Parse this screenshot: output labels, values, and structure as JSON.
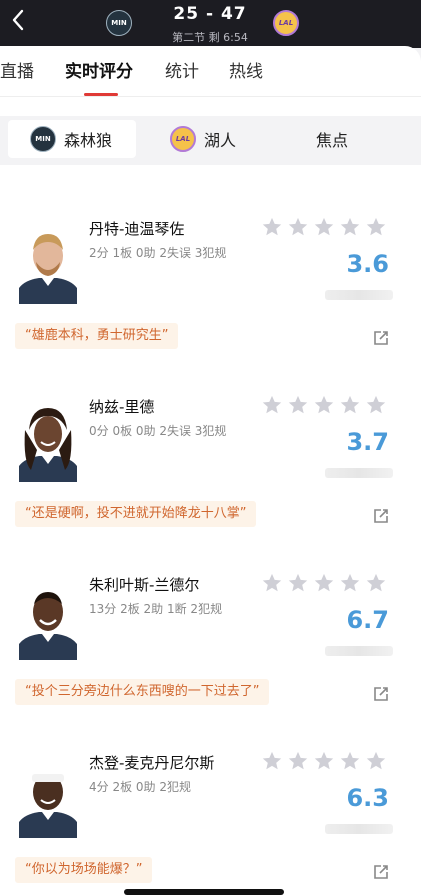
{
  "header": {
    "score": "25 - 47",
    "period": "第二节 剩 6:54",
    "home_logo_text": "MIN",
    "away_logo_text": "LAL"
  },
  "tabs": [
    {
      "label": "直播"
    },
    {
      "label": "实时评分"
    },
    {
      "label": "统计"
    },
    {
      "label": "热线"
    }
  ],
  "segments": [
    {
      "label": "森林狼",
      "logo_text": "MIN"
    },
    {
      "label": "湖人",
      "logo_text": "LAL"
    },
    {
      "label": "焦点"
    }
  ],
  "players": [
    {
      "name": "丹特-迪温琴佐",
      "stats": "2分 1板 0助 2失误 3犯规",
      "rating": "3.6",
      "stars": 0,
      "comment": "“雄鹿本科，勇士研究生”"
    },
    {
      "name": "纳兹-里德",
      "stats": "0分 0板 0助 2失误 3犯规",
      "rating": "3.7",
      "stars": 0,
      "comment": "“还是硬啊，投不进就开始降龙十八掌”"
    },
    {
      "name": "朱利叶斯-兰德尔",
      "stats": "13分 2板 2助 1断 2犯规",
      "rating": "6.7",
      "stars": 0,
      "comment": "“投个三分旁边什么东西嗖的一下过去了”"
    },
    {
      "name": "杰登-麦克丹尼尔斯",
      "stats": "4分 2板 0助 2犯规",
      "rating": "6.3",
      "stars": 0,
      "comment": "“你以为场场能爆？”"
    }
  ],
  "colors": {
    "accent": "#e03a36",
    "rating": "#4a9ad8",
    "comment_text": "#d0662e",
    "comment_bg": "#fdf3e8",
    "star_empty": "#cfcfd6"
  },
  "icons": {
    "back": "chevron-left-icon",
    "share": "share-icon",
    "star": "star-icon"
  }
}
